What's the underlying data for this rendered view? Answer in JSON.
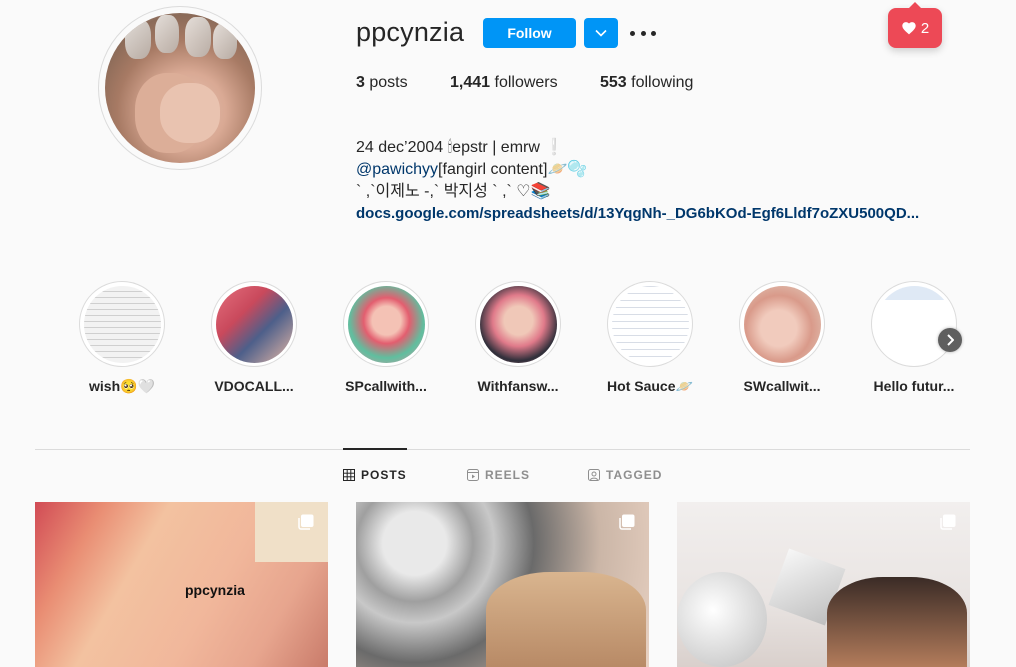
{
  "profile": {
    "username": "ppcynzia",
    "follow_label": "Follow",
    "posts_count": "3",
    "posts_label": "posts",
    "followers_count": "1,441",
    "followers_label": "followers",
    "following_count": "553",
    "following_label": "following"
  },
  "notification": {
    "count": "2",
    "icon": "heart-icon"
  },
  "bio": {
    "line1": "24 dec’2004 🕯epstr | emrw   ❕",
    "mention": "@pawichyy",
    "line2_rest": "[fangirl content]🪐🫧",
    "line3": "` ,`이제노 -,` 박지성 ` ,` ♡📚",
    "link": "docs.google.com/spreadsheets/d/13YqgNh-_DG6bKOd-Egf6Lldf7oZXU500QD..."
  },
  "highlights": [
    {
      "label": "wish🥺🤍"
    },
    {
      "label": "VDOCALL..."
    },
    {
      "label": "SPcallwith..."
    },
    {
      "label": "Withfansw..."
    },
    {
      "label": "Hot Sauce🪐"
    },
    {
      "label": "SWcallwit..."
    },
    {
      "label": "Hello futur..."
    }
  ],
  "tabs": [
    {
      "label": "POSTS",
      "icon": "grid-icon",
      "active": true
    },
    {
      "label": "REELS",
      "icon": "reels-icon",
      "active": false
    },
    {
      "label": "TAGGED",
      "icon": "tagged-icon",
      "active": false
    }
  ],
  "posts": [
    {
      "caption": "ppcynzia"
    },
    {
      "caption": ""
    },
    {
      "caption": ""
    }
  ],
  "colors": {
    "accent": "#0095f6",
    "notification": "#ed4956",
    "link": "#00376b"
  }
}
